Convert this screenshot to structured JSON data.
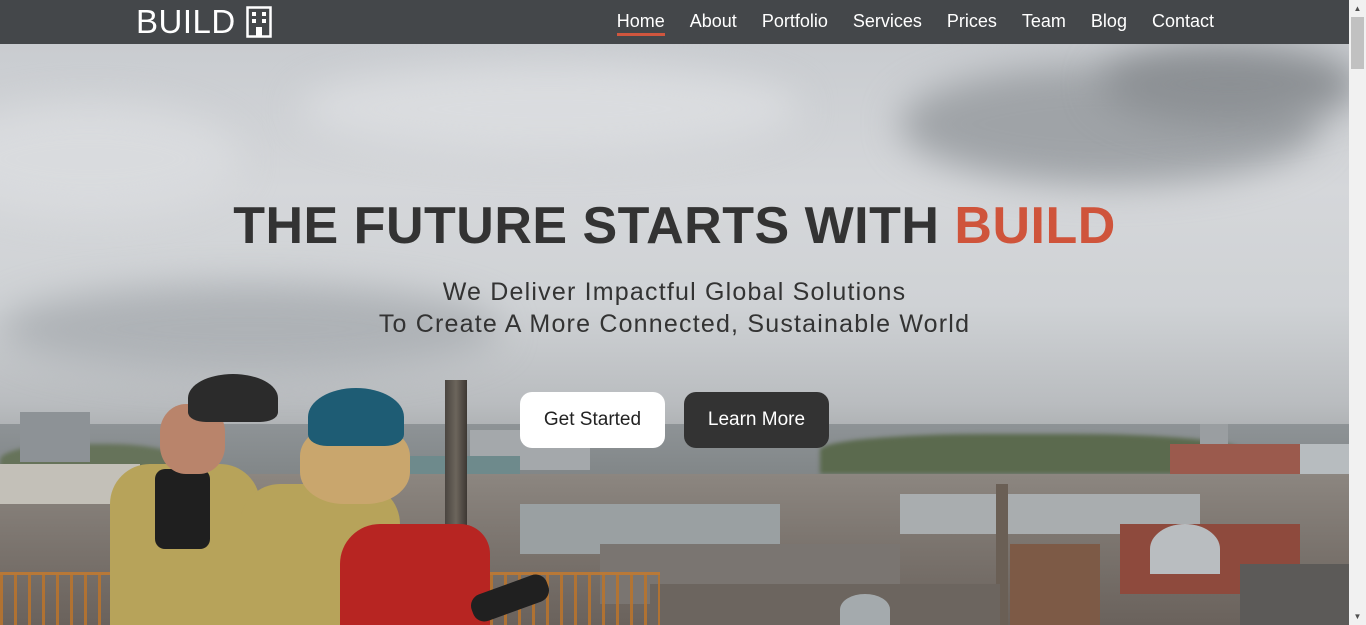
{
  "brand": {
    "name": "BUILD",
    "icon": "building-icon"
  },
  "nav": {
    "items": [
      {
        "label": "Home",
        "active": true
      },
      {
        "label": "About"
      },
      {
        "label": "Portfolio"
      },
      {
        "label": "Services"
      },
      {
        "label": "Prices"
      },
      {
        "label": "Team"
      },
      {
        "label": "Blog"
      },
      {
        "label": "Contact"
      }
    ]
  },
  "hero": {
    "title_main": "THE FUTURE STARTS WITH ",
    "title_accent": "BUILD",
    "subtitle_line1": "We Deliver Impactful Global Solutions",
    "subtitle_line2": "To Create A More Connected, Sustainable World",
    "primary_button": "Get Started",
    "secondary_button": "Learn More"
  },
  "colors": {
    "navbar_bg": "#44474a",
    "accent": "#cf543b",
    "title_text": "#333333",
    "primary_button_bg": "#ffffff",
    "secondary_button_bg": "#333333"
  }
}
